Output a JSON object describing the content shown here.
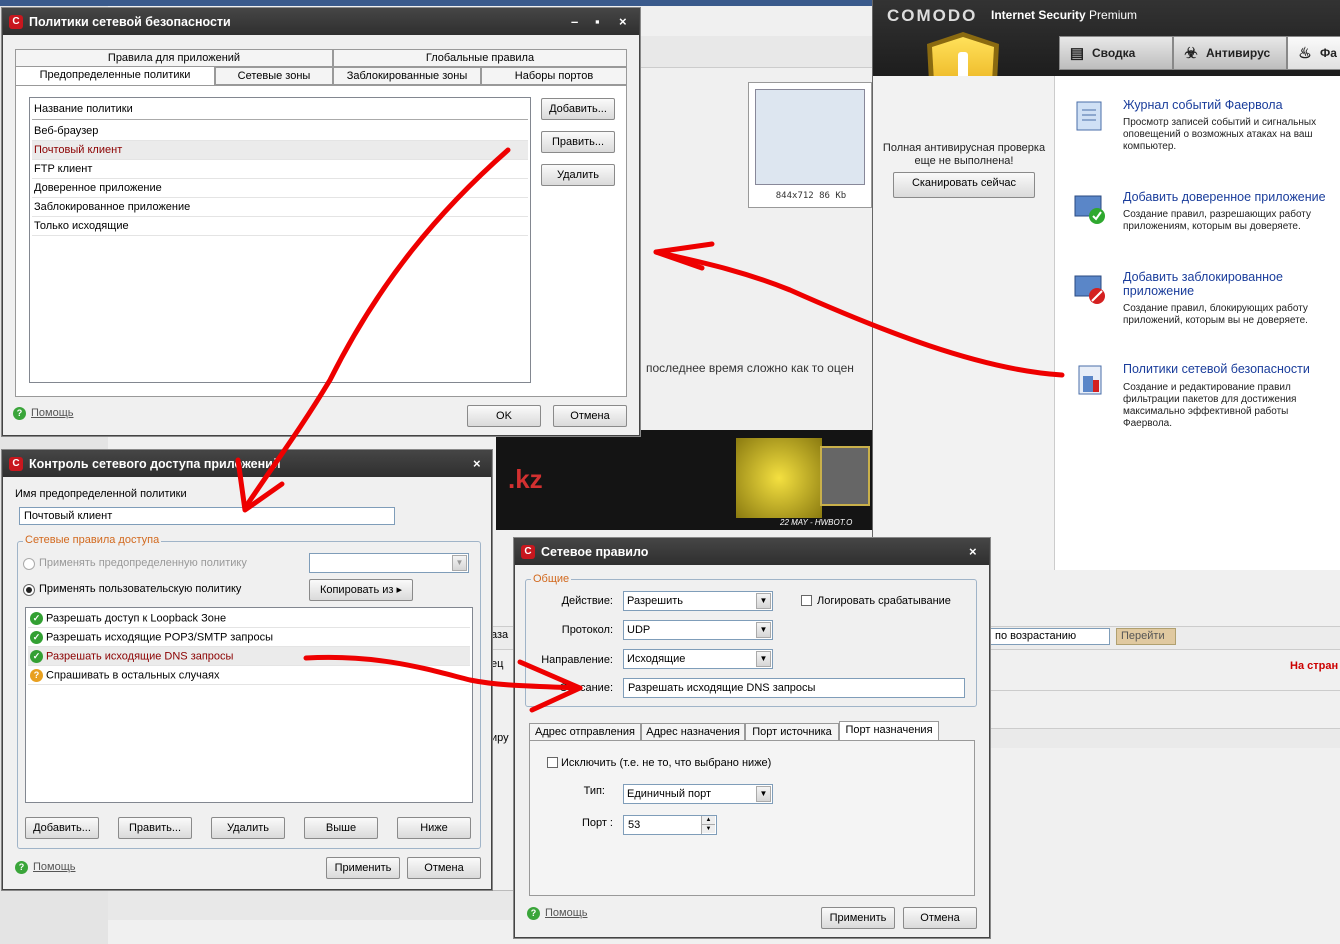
{
  "comodo": {
    "logo": "COMODO",
    "product_name": "Internet Security",
    "product_edition": "Premium",
    "tabs": [
      {
        "label": "Сводка",
        "icon": "summary-icon"
      },
      {
        "label": "Антивирус",
        "icon": "biohazard-icon"
      },
      {
        "label": "Фа",
        "icon": "firewall-flame-icon"
      }
    ],
    "scan_text": "Полная антивирусная проверка еще не выполнена!",
    "scan_button": "Сканировать сейчас",
    "items": [
      {
        "title": "Журнал событий Фаервола",
        "desc": "Просмотр записей событий и сигнальных оповещений о возможных атаках на ваш компьютер."
      },
      {
        "title": "Добавить доверенное приложение",
        "desc": "Создание правил, разрешающих работу приложениям, которым вы доверяете."
      },
      {
        "title": "Добавить заблокированное приложение",
        "desc": "Создание правил, блокирующих работу приложений, которым вы не доверяете."
      },
      {
        "title": "Политики сетевой безопасности",
        "desc": "Создание и редактирование правил фильтрации пакетов для достижения максимально эффективной работы Фаервола."
      }
    ]
  },
  "background": {
    "thumb_caption": "844x712  86 Kb",
    "text1": "последнее время сложно как то оцен",
    "banner_text": ".kz",
    "banner_caption": "22 MAY - HWBOT.O",
    "sort_value": "по возрастанию",
    "go_button": "Перейти",
    "red_text": "На стран",
    "frag1": "аза",
    "frag2": "ец",
    "frag3": "иру"
  },
  "policies": {
    "title": "Политики сетевой безопасности",
    "tabs_top": [
      "Правила для приложений",
      "Глобальные правила"
    ],
    "tabs_bottom": [
      "Предопределенные политики",
      "Сетевые зоны",
      "Заблокированные зоны",
      "Наборы портов"
    ],
    "list_header": "Название политики",
    "items": [
      "Веб-браузер",
      "Почтовый клиент",
      "FTP клиент",
      "Доверенное приложение",
      "Заблокированное приложение",
      "Только исходящие"
    ],
    "btn_add": "Добавить...",
    "btn_edit": "Править...",
    "btn_delete": "Удалить",
    "help": "Помощь",
    "btn_ok": "OK",
    "btn_cancel": "Отмена"
  },
  "appctl": {
    "title": "Контроль сетевого доступа приложений",
    "name_label": "Имя предопределенной политики",
    "name_value": "Почтовый клиент",
    "group_label": "Сетевые правила доступа",
    "radio_predef": "Применять предопределенную политику",
    "radio_custom": "Применять пользовательскую политику",
    "copy_btn": "Копировать из",
    "rules": [
      "Разрешать доступ к Loopback Зоне",
      "Разрешать исходящие POP3/SMTP запросы",
      "Разрешать исходящие DNS запросы",
      "Спрашивать в остальных случаях"
    ],
    "btn_add": "Добавить...",
    "btn_edit": "Править...",
    "btn_delete": "Удалить",
    "btn_up": "Выше",
    "btn_down": "Ниже",
    "help": "Помощь",
    "btn_apply": "Применить",
    "btn_cancel": "Отмена"
  },
  "netrule": {
    "title": "Сетевое правило",
    "group_label": "Общие",
    "action_label": "Действие:",
    "action_value": "Разрешить",
    "log_label": "Логировать срабатывание",
    "protocol_label": "Протокол:",
    "protocol_value": "UDP",
    "direction_label": "Направление:",
    "direction_value": "Исходящие",
    "desc_label": "Описание:",
    "desc_value": "Разрешать исходящие DNS запросы",
    "tabs": [
      "Адрес отправления",
      "Адрес назначения",
      "Порт источника",
      "Порт назначения"
    ],
    "exclude_label": "Исключить (т.е. не то, что выбрано ниже)",
    "type_label": "Тип:",
    "type_value": "Единичный порт",
    "port_label": "Порт :",
    "port_value": "53",
    "help": "Помощь",
    "btn_apply": "Применить",
    "btn_cancel": "Отмена"
  },
  "colors": {
    "arrow": "#ee0000",
    "link": "#1a3d9b",
    "group_label": "#d2691e"
  }
}
